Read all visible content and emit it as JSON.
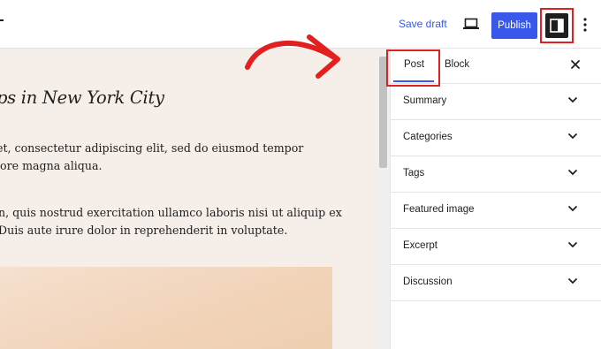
{
  "toolbar": {
    "save_draft_label": "Save draft",
    "publish_label": "Publish",
    "icons": {
      "preview": "desktop-preview-icon",
      "settings": "sidebar-settings-icon",
      "more": "vertical-ellipsis-icon"
    }
  },
  "editor": {
    "title": "ps in New York City",
    "paragraphs": [
      {
        "lines": [
          "et, consectetur adipiscing elit, sed do eiusmod tempor",
          "lore magna aliqua."
        ]
      },
      {
        "lines": [
          "n, quis nostrud exercitation ullamco laboris nisi ut aliquip ex",
          "Duis aute irure dolor in reprehenderit in voluptate."
        ]
      }
    ]
  },
  "sidebar": {
    "tabs": [
      {
        "label": "Post",
        "active": true
      },
      {
        "label": "Block",
        "active": false
      }
    ],
    "panels": [
      {
        "label": "Summary"
      },
      {
        "label": "Categories"
      },
      {
        "label": "Tags"
      },
      {
        "label": "Featured image"
      },
      {
        "label": "Excerpt"
      },
      {
        "label": "Discussion"
      }
    ]
  },
  "colors": {
    "accent": "#3858e9",
    "highlight": "#e32020",
    "canvas_bg": "#f6efe9"
  }
}
